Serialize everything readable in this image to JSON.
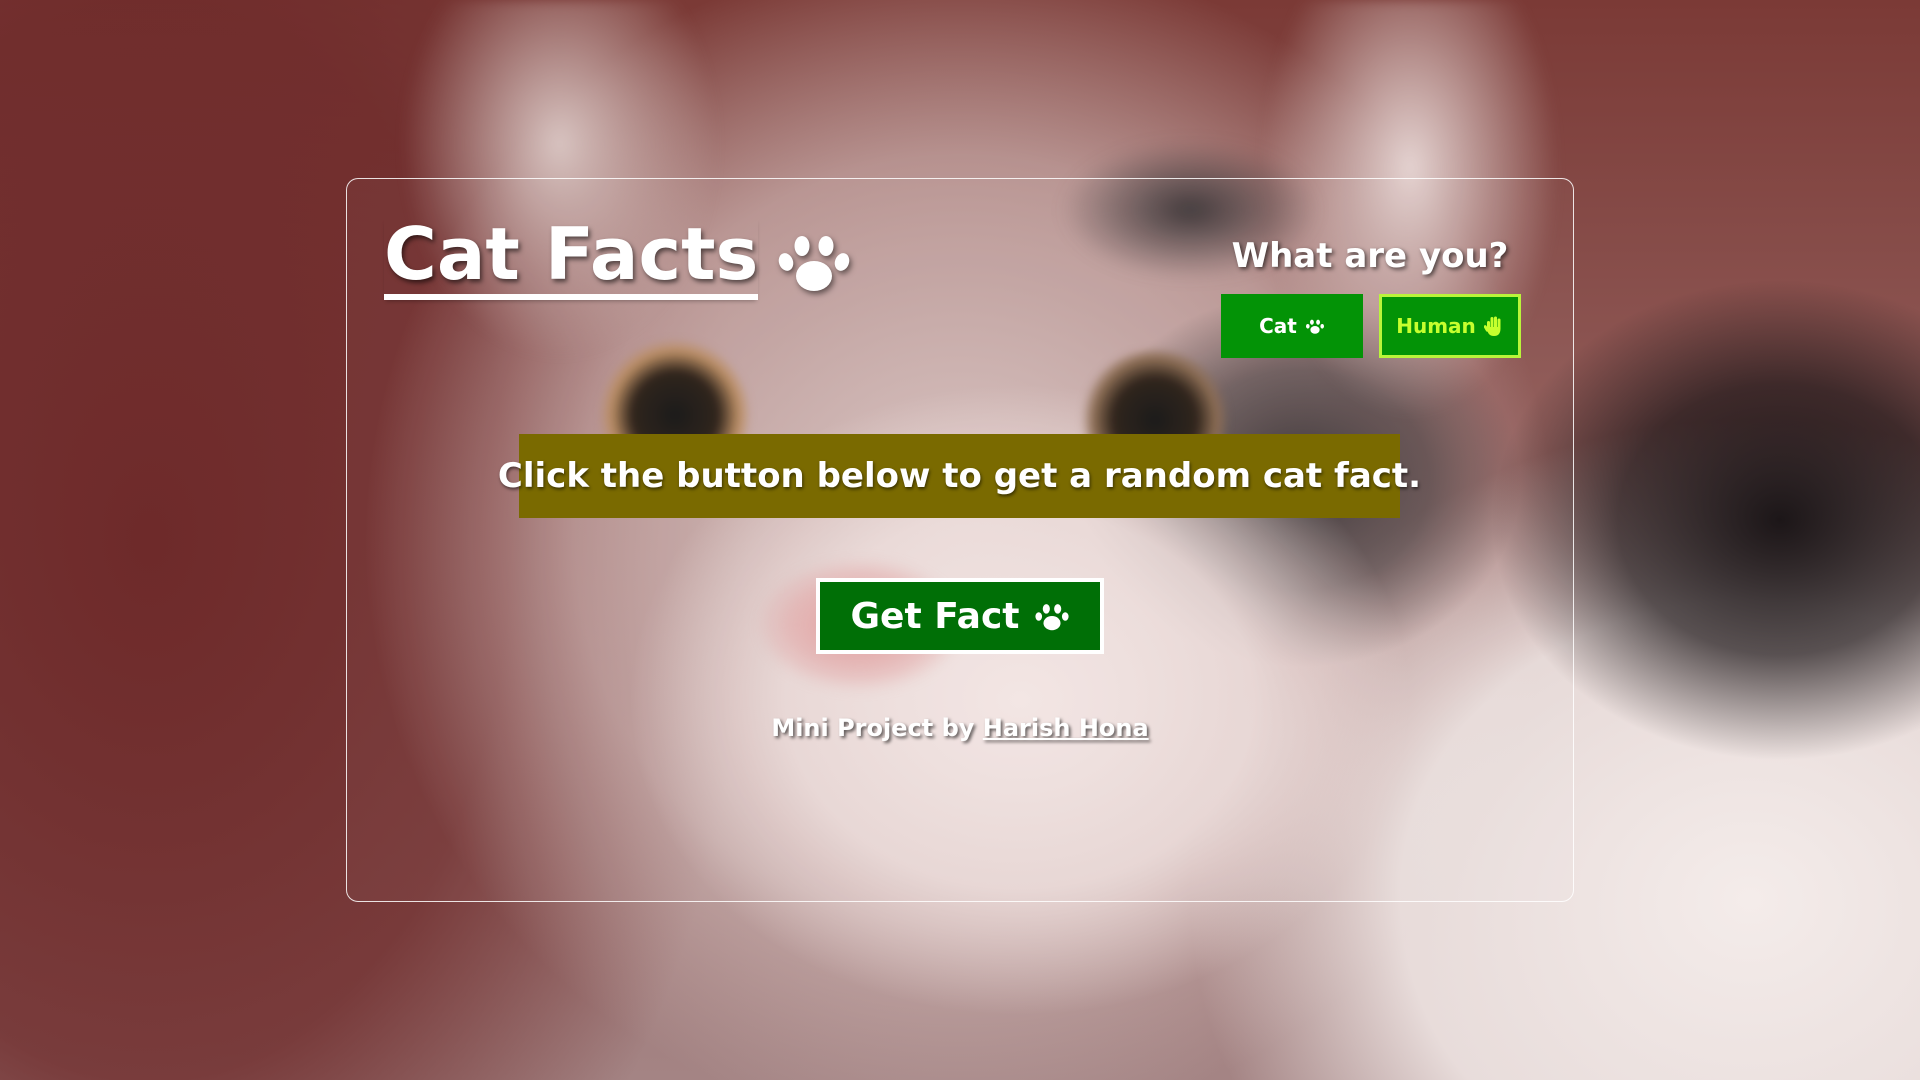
{
  "app": {
    "title": "Cat Facts",
    "title_icon": "paw-icon"
  },
  "selector": {
    "question": "What are you?",
    "options": [
      {
        "label": "Cat",
        "icon": "paw-icon",
        "selected": false
      },
      {
        "label": "Human",
        "icon": "hand-icon",
        "selected": true
      }
    ]
  },
  "fact": {
    "text": "Click the button below to get a random cat fact."
  },
  "action": {
    "label": "Get Fact",
    "icon": "paw-icon"
  },
  "footer": {
    "prefix": "Mini Project by",
    "author": "Harish Hona"
  },
  "colors": {
    "cat_button_bg": "#039306",
    "human_button_text": "#c6ff2e",
    "human_button_border": "#b9f53a",
    "fact_bg": "#7a6a00",
    "get_fact_bg": "#006f06"
  }
}
